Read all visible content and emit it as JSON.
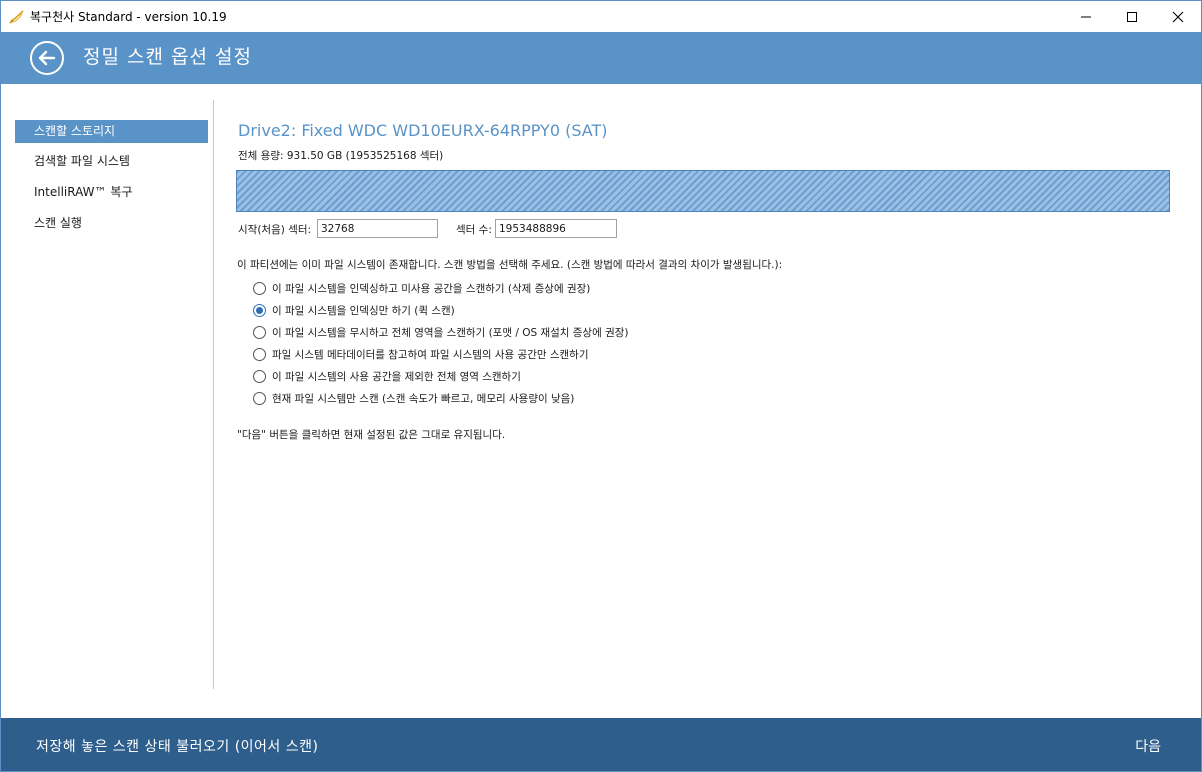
{
  "window": {
    "title": "복구천사 Standard - version 10.19",
    "controls": [
      "minimize-icon",
      "maximize-icon",
      "close-icon"
    ]
  },
  "header": {
    "title": "정밀 스캔 옵션 설정",
    "back_icon": "arrow-left-circle-icon"
  },
  "sidebar": {
    "items": [
      {
        "label": "스캔할 스토리지",
        "active": true
      },
      {
        "label": "검색할 파일 시스템",
        "active": false
      },
      {
        "label": "IntelliRAW™ 복구",
        "active": false
      },
      {
        "label": "스캔 실행",
        "active": false
      }
    ]
  },
  "main": {
    "drive_title": "Drive2: Fixed WDC WD10EURX-64RPPY0 (SAT)",
    "capacity": "전체 용량: 931.50 GB (1953525168 섹터)",
    "start_sector_label": "시작(처음) 섹터:",
    "start_sector_value": "32768",
    "sector_count_label": "섹터 수:",
    "sector_count_value": "1953488896",
    "notice": "이 파티션에는 이미 파일 시스템이 존재합니다. 스캔 방법을 선택해 주세요. (스캔 방법에 따라서 결과의 차이가 발생됩니다.):",
    "options": [
      {
        "label": "이 파일 시스템을 인덱싱하고 미사용 공간을 스캔하기 (삭제 증상에 권장)",
        "checked": false
      },
      {
        "label": "이 파일 시스템을 인덱싱만 하기 (퀵 스캔)",
        "checked": true
      },
      {
        "label": "이 파일 시스템을 무시하고 전체 영역을 스캔하기 (포맷 / OS 재설치 증상에 권장)",
        "checked": false
      },
      {
        "label": "파일 시스템 메타데이터를 참고하여 파일 시스템의 사용 공간만 스캔하기",
        "checked": false
      },
      {
        "label": "이 파일 시스템의 사용 공간을 제외한 전체 영역 스캔하기",
        "checked": false
      },
      {
        "label": "현재 파일 시스템만 스캔 (스캔 속도가 빠르고, 메모리 사용량이 낮음)",
        "checked": false
      }
    ],
    "hint": "\"다음\" 버튼을 클릭하면 현재 설정된 값은 그대로 유지됩니다."
  },
  "footer": {
    "load_state": "저장해 놓은 스캔 상태 불러오기 (이어서 스캔)",
    "next": "다음"
  },
  "colors": {
    "accent": "#5a93c8",
    "footer": "#2e5f8c",
    "radio_checked": "#2f6fb5"
  }
}
